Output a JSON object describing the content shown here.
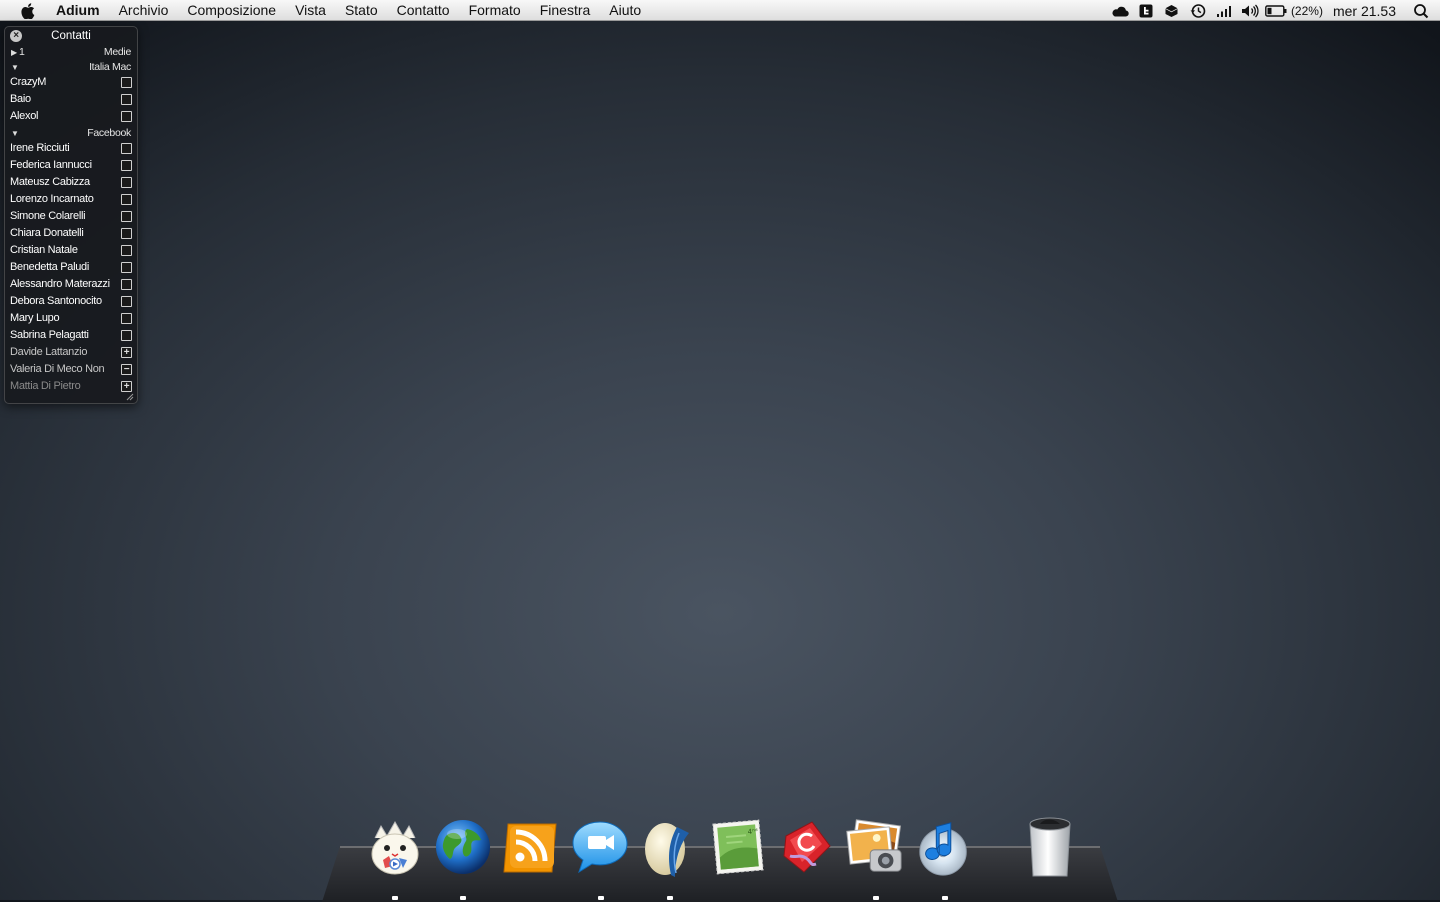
{
  "menubar": {
    "apple": "apple-icon",
    "app_name": "Adium",
    "items": [
      "Archivio",
      "Composizione",
      "Vista",
      "Stato",
      "Contatto",
      "Formato",
      "Finestra",
      "Aiuto"
    ],
    "status_icons": [
      "cloud-icon",
      "twitter-icon",
      "dropbox-icon",
      "time-machine-icon",
      "signal-icon",
      "volume-icon",
      "battery-icon"
    ],
    "battery_percent": "(22%)",
    "clock": "mer 21.53"
  },
  "contacts": {
    "title": "Contatti",
    "group_medie": {
      "count": "1",
      "label": "Medie"
    },
    "group_italia": {
      "label": "Italia Mac",
      "members": [
        "CrazyM",
        "Baio",
        "Alexol"
      ]
    },
    "group_facebook": {
      "label": "Facebook",
      "members": [
        "Irene Ricciuti",
        "Federica Iannucci",
        "Mateusz Cabizza",
        "Lorenzo Incarnato",
        "Simone Colarelli",
        "Chiara Donatelli",
        "Cristian Natale",
        "Benedetta Paludi",
        "Alessandro Materazzi",
        "Debora Santonocito",
        "Mary Lupo",
        "Sabrina Pelagatti",
        "Davide Lattanzio",
        "Valeria Di Meco Non",
        "Mattia Di Pietro"
      ]
    }
  },
  "dock": {
    "apps": [
      "togepi-app-icon",
      "globe-icon",
      "rss-reader-icon",
      "ichat-icon",
      "egg-app-icon",
      "stamp-mail-icon",
      "red-app-icon",
      "iphoto-icon",
      "itunes-icon"
    ],
    "trash": "trash-icon"
  },
  "colors": {
    "accent": "#4a90d9",
    "desktop": "#3a434f",
    "rss": "#f29400"
  }
}
